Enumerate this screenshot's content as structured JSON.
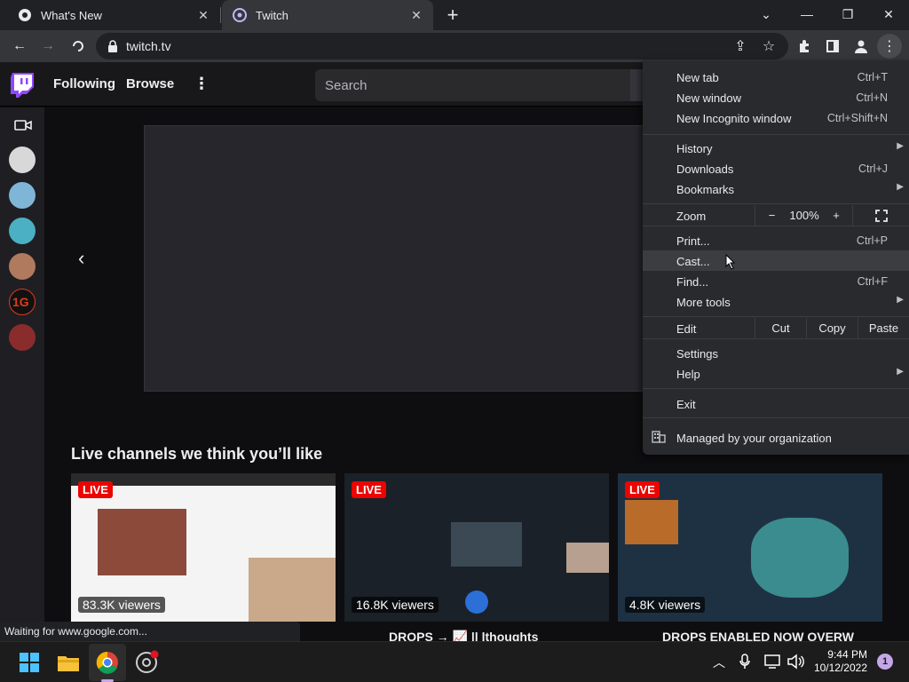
{
  "tabs": [
    {
      "title": "What's New",
      "icon": "chrome-icon"
    },
    {
      "title": "Twitch",
      "icon": "twitch-tab-icon"
    }
  ],
  "toolbar": {
    "url": "twitch.tv"
  },
  "twitch": {
    "nav": {
      "following": "Following",
      "browse": "Browse"
    },
    "search_placeholder": "Search",
    "section_title": "Live channels we think you’ll like",
    "live_label": "LIVE",
    "cards": [
      {
        "viewers": "83.3K viewers",
        "title": ""
      },
      {
        "viewers": "16.8K viewers",
        "title": "DROPS → 📈 || lthoughts"
      },
      {
        "viewers": "4.8K viewers",
        "title": "DROPS ENABLED NOW OVERW"
      }
    ]
  },
  "menu": {
    "new_tab": {
      "label": "New tab",
      "shortcut": "Ctrl+T"
    },
    "new_window": {
      "label": "New window",
      "shortcut": "Ctrl+N"
    },
    "new_incognito": {
      "label": "New Incognito window",
      "shortcut": "Ctrl+Shift+N"
    },
    "history": {
      "label": "History"
    },
    "downloads": {
      "label": "Downloads",
      "shortcut": "Ctrl+J"
    },
    "bookmarks": {
      "label": "Bookmarks"
    },
    "zoom": {
      "label": "Zoom",
      "minus": "−",
      "level": "100%",
      "plus": "+"
    },
    "print": {
      "label": "Print...",
      "shortcut": "Ctrl+P"
    },
    "cast": {
      "label": "Cast..."
    },
    "find": {
      "label": "Find...",
      "shortcut": "Ctrl+F"
    },
    "more_tools": {
      "label": "More tools"
    },
    "edit": {
      "label": "Edit",
      "cut": "Cut",
      "copy": "Copy",
      "paste": "Paste"
    },
    "settings": {
      "label": "Settings"
    },
    "help": {
      "label": "Help"
    },
    "exit": {
      "label": "Exit"
    },
    "managed": {
      "label": "Managed by your organization"
    }
  },
  "status_text": "Waiting for www.google.com...",
  "taskbar": {
    "time": "9:44 PM",
    "date": "10/12/2022",
    "notifications": "1"
  },
  "colors": {
    "twitch_purple": "#9147ff",
    "live_red": "#eb0400"
  }
}
